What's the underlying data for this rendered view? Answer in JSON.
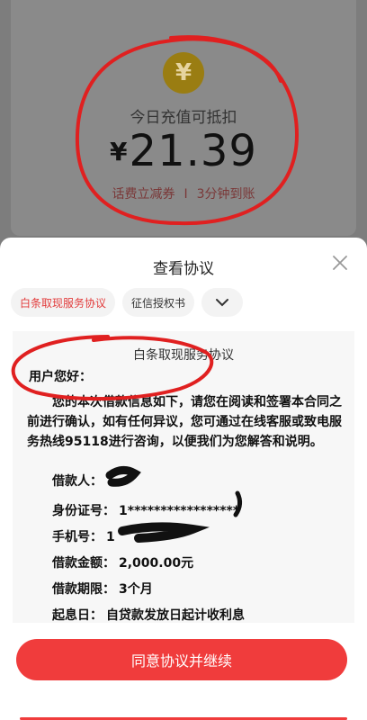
{
  "top": {
    "coin_glyph": "¥",
    "deduct_label": "今日充值可抵扣",
    "currency": "¥",
    "amount": "21.39",
    "promo_left": "话费立减券",
    "promo_sep": "I",
    "promo_right": "3分钟到账"
  },
  "sheet": {
    "title": "查看协议",
    "tabs": [
      "白条取现服务协议",
      "征信授权书"
    ],
    "active_tab": 0,
    "doc": {
      "title": "白条取现服务协议",
      "greeting": "用户您好：",
      "paragraph": "您的本次借款信息如下，请您在阅读和签署本合同之前进行确认，如有任何异议，您可通过在线客服或致电服务热线95118进行咨询，以便我们为您解答和说明。",
      "fields": [
        {
          "label": "借款人：",
          "value": ""
        },
        {
          "label": "身份证号：",
          "value": "1*****************"
        },
        {
          "label": "手机号：",
          "value": "1"
        },
        {
          "label": "借款金额：",
          "value": "2,000.00元"
        },
        {
          "label": "借款期限：",
          "value": "3个月"
        },
        {
          "label": "起息日：",
          "value": "自贷款发放日起计收利息"
        }
      ]
    },
    "cta_label": "同意协议并继续"
  },
  "colors": {
    "accent": "#f03c3c",
    "coin": "#9a7d12",
    "annotation": "#e02020"
  }
}
